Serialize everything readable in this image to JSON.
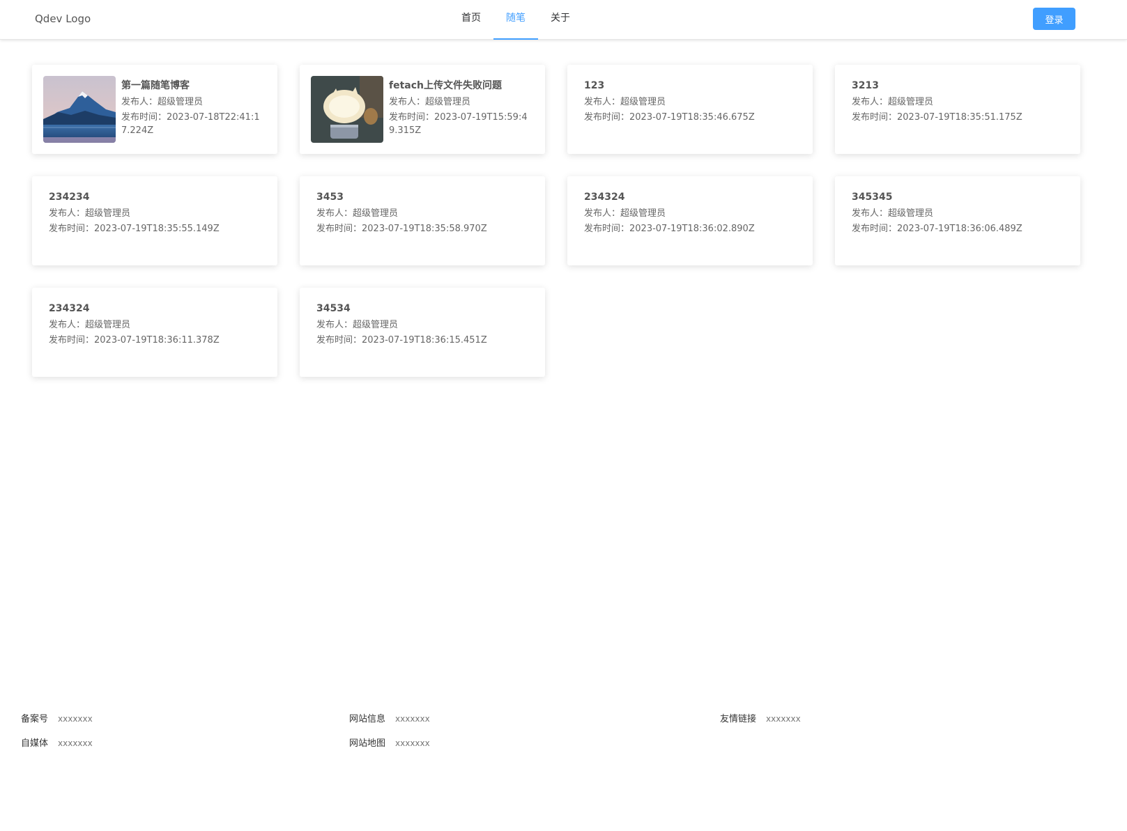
{
  "header": {
    "logo": "Qdev Logo",
    "nav": [
      {
        "label": "首页",
        "active": false
      },
      {
        "label": "随笔",
        "active": true
      },
      {
        "label": "关于",
        "active": false
      }
    ],
    "login_label": "登录"
  },
  "posts": [
    {
      "title": "第一篇随笔博客",
      "author": "发布人：超级管理员",
      "time": "发布时间：2023-07-18T22:41:17.224Z",
      "image": "mountain-lake-photo"
    },
    {
      "title": "fetach上传文件失败问题",
      "author": "发布人：超级管理员",
      "time": "发布时间：2023-07-19T15:59:49.315Z",
      "image": "pig-lamp-photo"
    },
    {
      "title": "123",
      "author": "发布人：超级管理员",
      "time": "发布时间：2023-07-19T18:35:46.675Z"
    },
    {
      "title": "3213",
      "author": "发布人：超级管理员",
      "time": "发布时间：2023-07-19T18:35:51.175Z"
    },
    {
      "title": "234234",
      "author": "发布人：超级管理员",
      "time": "发布时间：2023-07-19T18:35:55.149Z"
    },
    {
      "title": "3453",
      "author": "发布人：超级管理员",
      "time": "发布时间：2023-07-19T18:35:58.970Z"
    },
    {
      "title": "234324",
      "author": "发布人：超级管理员",
      "time": "发布时间：2023-07-19T18:36:02.890Z"
    },
    {
      "title": "345345",
      "author": "发布人：超级管理员",
      "time": "发布时间：2023-07-19T18:36:06.489Z"
    },
    {
      "title": "234324",
      "author": "发布人：超级管理员",
      "time": "发布时间：2023-07-19T18:36:11.378Z"
    },
    {
      "title": "34534",
      "author": "发布人：超级管理员",
      "time": "发布时间：2023-07-19T18:36:15.451Z"
    }
  ],
  "footer": [
    {
      "label": "备案号",
      "value": "xxxxxxx"
    },
    {
      "label": "网站信息",
      "value": "xxxxxxx"
    },
    {
      "label": "友情链接",
      "value": "xxxxxxx"
    },
    {
      "label": "自媒体",
      "value": "xxxxxxx"
    },
    {
      "label": "网站地图",
      "value": "xxxxxxx"
    }
  ],
  "colors": {
    "accent": "#409eff"
  }
}
